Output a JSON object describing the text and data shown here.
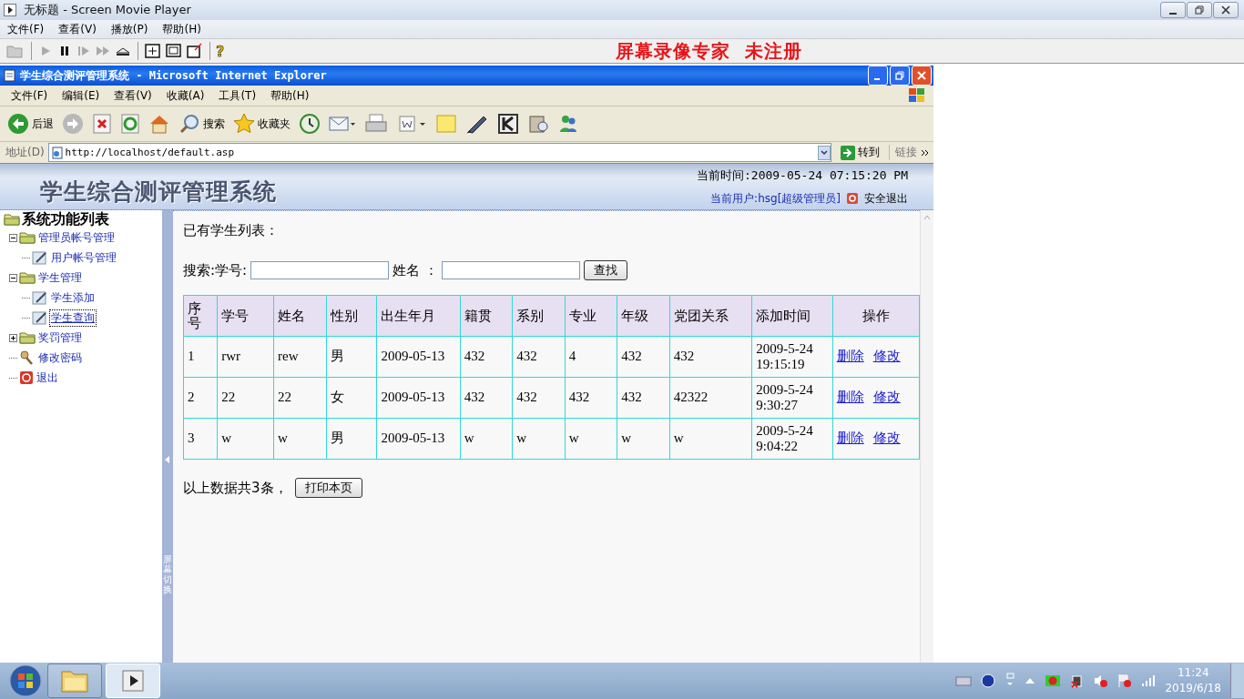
{
  "player": {
    "title": "无标题 - Screen Movie Player",
    "menu": [
      "文件(F)",
      "查看(V)",
      "播放(P)",
      "帮助(H)"
    ],
    "help_glyph": "?",
    "banner": "屏幕录像专家  未注册"
  },
  "browser": {
    "title": "学生综合测评管理系统 - Microsoft Internet Explorer",
    "menu": [
      "文件(F)",
      "编辑(E)",
      "查看(V)",
      "收藏(A)",
      "工具(T)",
      "帮助(H)"
    ],
    "toolbar": [
      {
        "kind": "back",
        "label": "后退"
      },
      {
        "kind": "forward"
      },
      {
        "kind": "stop"
      },
      {
        "kind": "refresh"
      },
      {
        "kind": "home"
      },
      {
        "kind": "search",
        "label": "搜索"
      },
      {
        "kind": "favorites",
        "label": "收藏夹"
      },
      {
        "kind": "history"
      },
      {
        "kind": "mail"
      },
      {
        "kind": "print"
      },
      {
        "kind": "edit"
      },
      {
        "kind": "note"
      },
      {
        "kind": "pen"
      },
      {
        "kind": "kbox"
      },
      {
        "kind": "tool"
      },
      {
        "kind": "messenger"
      }
    ],
    "address_label": "地址(D)",
    "url": "http://localhost/default.asp",
    "go": "转到",
    "links": "链接"
  },
  "header": {
    "logo": "学生综合测评管理系统",
    "time": "当前时间:2009-05-24 07:15:20 PM",
    "user": "当前用户:hsg[超级管理员]",
    "logout": "安全退出"
  },
  "nav": {
    "title": "系统功能列表",
    "items": [
      {
        "label": "管理员帐号管理",
        "kind": "folder",
        "expanded": true,
        "selected": false,
        "children": [
          {
            "label": "用户帐号管理",
            "kind": "page",
            "selected": false
          }
        ]
      },
      {
        "label": "学生管理",
        "kind": "folder",
        "expanded": true,
        "selected": false,
        "children": [
          {
            "label": "学生添加",
            "kind": "page",
            "selected": false
          },
          {
            "label": "学生查询",
            "kind": "page",
            "selected": true
          }
        ]
      },
      {
        "label": "奖罚管理",
        "kind": "folder",
        "expanded": false,
        "selected": false
      },
      {
        "label": "修改密码",
        "kind": "key",
        "selected": false
      },
      {
        "label": "退出",
        "kind": "exit",
        "selected": false
      }
    ]
  },
  "splitter": "屏幕切换",
  "content": {
    "heading": "已有学生列表：",
    "search_label": "搜索:学号:",
    "name_label": "姓名 ：",
    "search_button": "查找",
    "columns": [
      "序号",
      "学号",
      "姓名",
      "性别",
      "出生年月",
      "籍贯",
      "系别",
      "专业",
      "年级",
      "党团关系",
      "添加时间",
      "操作"
    ],
    "rows": [
      {
        "cells": [
          "1",
          "rwr",
          "rew",
          "男",
          "2009-05-13",
          "432",
          "432",
          "4",
          "432",
          "432",
          "2009-5-24\n19:15:19"
        ],
        "actions": [
          "删除",
          "修改"
        ]
      },
      {
        "cells": [
          "2",
          "22",
          "22",
          "女",
          "2009-05-13",
          "432",
          "432",
          "432",
          "432",
          "42322",
          "2009-5-24\n9:30:27"
        ],
        "actions": [
          "删除",
          "修改"
        ]
      },
      {
        "cells": [
          "3",
          "w",
          "w",
          "男",
          "2009-05-13",
          "w",
          "w",
          "w",
          "w",
          "w",
          "2009-5-24\n9:04:22"
        ],
        "actions": [
          "删除",
          "修改"
        ]
      }
    ],
    "summary": "以上数据共3条，",
    "print_button": "打印本页"
  },
  "taskbar": {
    "buttons": [
      {
        "kind": "folder",
        "selected": false
      },
      {
        "kind": "player",
        "selected": true
      }
    ],
    "time": "11:24",
    "date": "2019/6/18"
  }
}
